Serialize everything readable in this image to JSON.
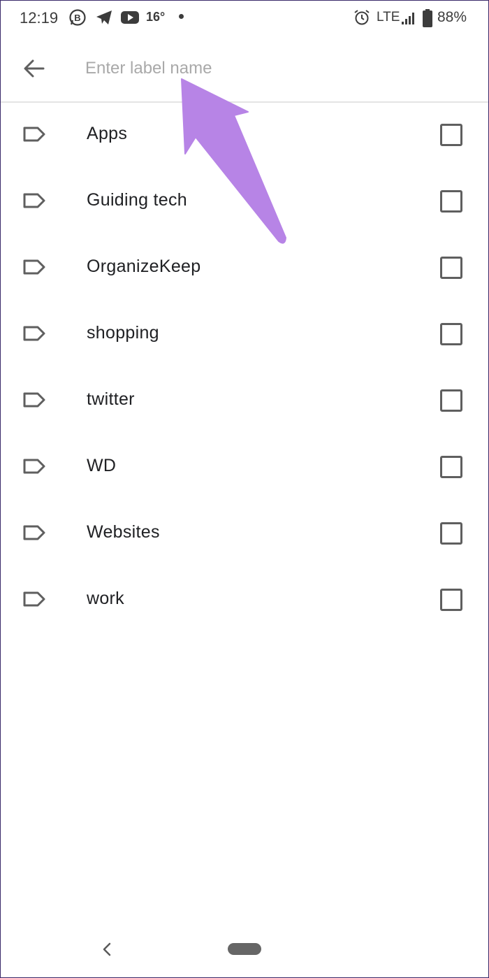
{
  "status_bar": {
    "time": "12:19",
    "temperature": "16°",
    "network": "LTE",
    "battery": "88%",
    "icons": [
      "whatsapp-business-icon",
      "telegram-icon",
      "youtube-icon",
      "alarm-icon",
      "signal-icon",
      "battery-icon"
    ]
  },
  "header": {
    "back_icon": "arrow-left-icon",
    "search_placeholder": "Enter label name",
    "search_value": ""
  },
  "labels": [
    {
      "name": "Apps",
      "checked": false
    },
    {
      "name": "Guiding tech",
      "checked": false
    },
    {
      "name": "OrganizeKeep",
      "checked": false
    },
    {
      "name": "shopping",
      "checked": false
    },
    {
      "name": "twitter",
      "checked": false
    },
    {
      "name": "WD",
      "checked": false
    },
    {
      "name": "Websites",
      "checked": false
    },
    {
      "name": "work",
      "checked": false
    }
  ],
  "nav_bar": {
    "back_icon": "chevron-left-icon",
    "home_icon": "home-pill-icon"
  },
  "annotation": {
    "color": "#b784e6"
  },
  "colors": {
    "icon": "#5f5f5f",
    "text": "#202124",
    "placeholder": "#a9a9a9",
    "divider": "#e4e4e4"
  }
}
